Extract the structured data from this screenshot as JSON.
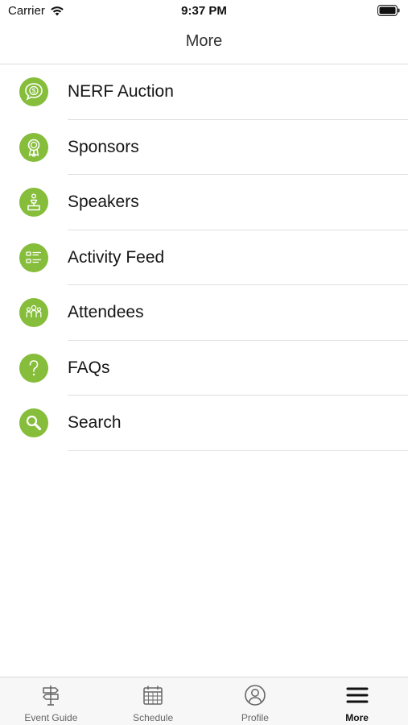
{
  "status_bar": {
    "carrier": "Carrier",
    "time": "9:37 PM"
  },
  "header": {
    "title": "More"
  },
  "menu": {
    "items": [
      {
        "label": "NERF Auction",
        "icon": "dollar-speech-bubble-icon"
      },
      {
        "label": "Sponsors",
        "icon": "award-ribbon-icon"
      },
      {
        "label": "Speakers",
        "icon": "podium-icon"
      },
      {
        "label": "Activity Feed",
        "icon": "feed-list-icon"
      },
      {
        "label": "Attendees",
        "icon": "people-group-icon"
      },
      {
        "label": "FAQs",
        "icon": "question-mark-icon"
      },
      {
        "label": "Search",
        "icon": "magnifier-icon"
      }
    ]
  },
  "tab_bar": {
    "tabs": [
      {
        "label": "Event Guide",
        "icon": "signpost-icon",
        "active": false
      },
      {
        "label": "Schedule",
        "icon": "calendar-icon",
        "active": false
      },
      {
        "label": "Profile",
        "icon": "profile-icon",
        "active": false
      },
      {
        "label": "More",
        "icon": "hamburger-menu-icon",
        "active": true
      }
    ]
  },
  "colors": {
    "accent_green": "#86bd3b",
    "icon_foreground": "#ffffff",
    "tab_bar_background": "#f7f7f7"
  }
}
